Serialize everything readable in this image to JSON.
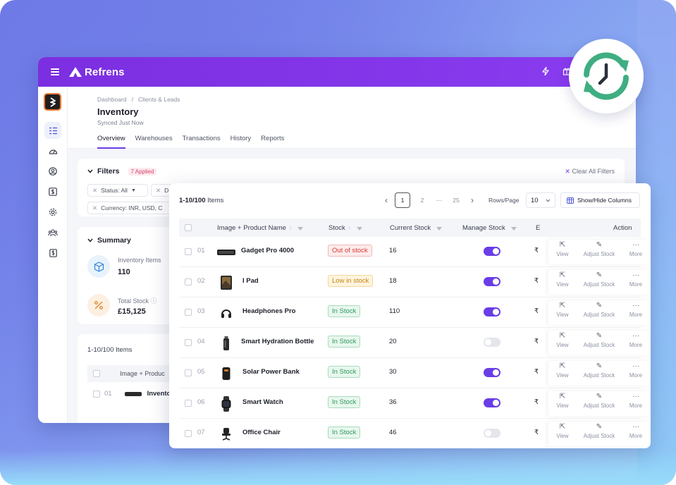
{
  "app": {
    "logo_text": "Refrens",
    "accent": "#7b2fe0"
  },
  "breadcrumb": {
    "items": [
      "Dashboard",
      "Clients & Leads"
    ]
  },
  "page": {
    "title": "Inventory",
    "subtitle": "Synced Just Now"
  },
  "tabs": [
    "Overview",
    "Warehouses",
    "Transactions",
    "History",
    "Reports"
  ],
  "filters": {
    "title": "Filters",
    "applied": "7 Applied",
    "clear": "Clear All Filters",
    "chips": [
      "Status: All",
      "D",
      "Currency: INR, USD, C"
    ]
  },
  "summary": {
    "title": "Summary",
    "items": [
      {
        "label": "Inventory Items",
        "value": "110"
      },
      {
        "label": "Total Stock",
        "value": "£15,125"
      }
    ]
  },
  "bg_table": {
    "count": "1-10/100 Items",
    "header": "Image + Produc",
    "row_num": "01",
    "row_name": "Invento"
  },
  "table": {
    "count_range": "1-10/100",
    "count_unit": "Items",
    "pages": [
      "1",
      "2",
      "···",
      "25"
    ],
    "rows_per_page_label": "Rows/Page",
    "rows_per_page": "10",
    "show_hide": "Show/Hide Columns",
    "columns": {
      "product": "Image + Product Name",
      "stock": "Stock",
      "current": "Current Stock",
      "manage": "Manage Stock",
      "extra": "E",
      "action": "Action"
    },
    "action_labels": {
      "view": "View",
      "adjust": "Adjust Stock",
      "more": "More"
    },
    "currency_symbol": "₹",
    "rows": [
      {
        "num": "01",
        "name": "Gadget Pro 4000",
        "status": "Out of stock",
        "status_type": "out",
        "current": "16",
        "manage": true,
        "thumb": "speaker"
      },
      {
        "num": "02",
        "name": "I Pad",
        "status": "Low in stock",
        "status_type": "low",
        "current": "18",
        "manage": true,
        "thumb": "tablet"
      },
      {
        "num": "03",
        "name": "Headphones Pro",
        "status": "In Stock",
        "status_type": "in",
        "current": "110",
        "manage": true,
        "thumb": "headphones"
      },
      {
        "num": "04",
        "name": "Smart Hydration Bottle",
        "status": "In Stock",
        "status_type": "in",
        "current": "20",
        "manage": false,
        "thumb": "bottle"
      },
      {
        "num": "05",
        "name": "Solar Power Bank",
        "status": "In Stock",
        "status_type": "in",
        "current": "30",
        "manage": true,
        "thumb": "powerbank"
      },
      {
        "num": "06",
        "name": "Smart Watch",
        "status": "In Stock",
        "status_type": "in",
        "current": "36",
        "manage": true,
        "thumb": "watch"
      },
      {
        "num": "07",
        "name": "Office Chair",
        "status": "In Stock",
        "status_type": "in",
        "current": "46",
        "manage": false,
        "thumb": "chair"
      }
    ]
  }
}
